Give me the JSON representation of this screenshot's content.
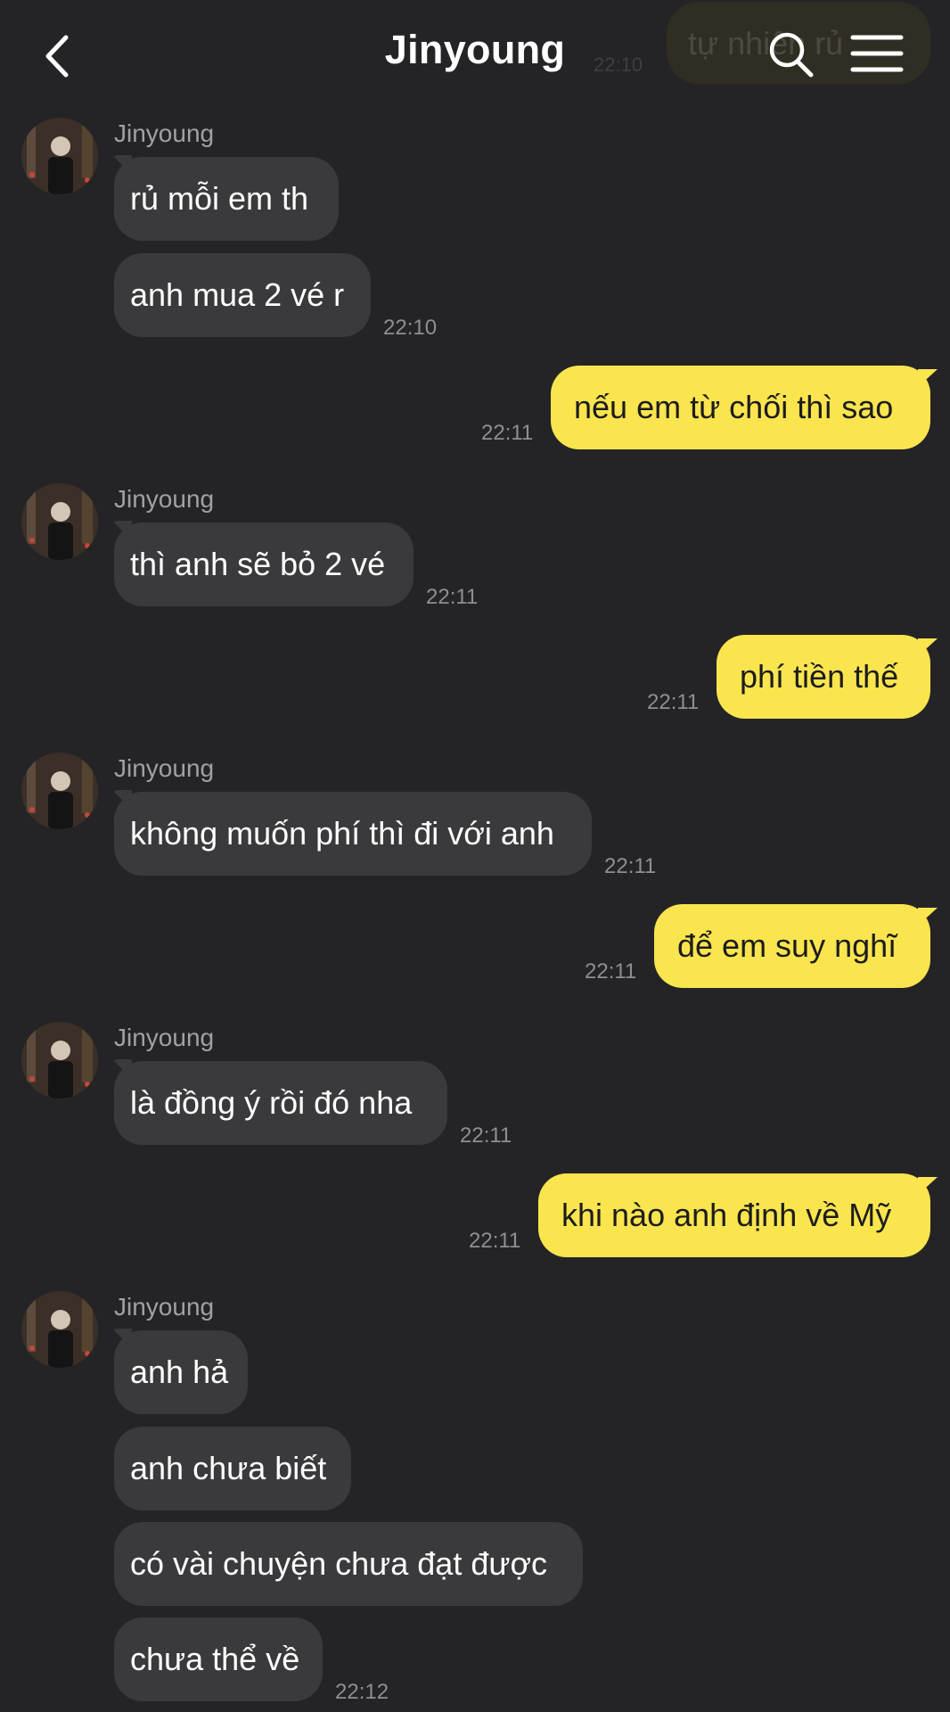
{
  "header": {
    "title": "Jinyoung",
    "background_message": "tự nhiên rủ",
    "background_time": "22:10"
  },
  "contact_name": "Jinyoung",
  "messages": {
    "g1": {
      "sender": "Jinyoung",
      "m1": "rủ mỗi em th",
      "m2": "anh mua 2 vé r",
      "time": "22:10"
    },
    "o1": {
      "text": "nếu em từ chối thì sao",
      "time": "22:11"
    },
    "g2": {
      "sender": "Jinyoung",
      "m1": "thì anh sẽ bỏ 2 vé",
      "time": "22:11"
    },
    "o2": {
      "text": "phí tiền thế",
      "time": "22:11"
    },
    "g3": {
      "sender": "Jinyoung",
      "m1": "không muốn phí thì đi với anh",
      "time": "22:11"
    },
    "o3": {
      "text": "để em suy nghĩ",
      "time": "22:11"
    },
    "g4": {
      "sender": "Jinyoung",
      "m1": "là đồng ý rồi đó nha",
      "time": "22:11"
    },
    "o4": {
      "text": "khi nào anh định về Mỹ",
      "time": "22:11"
    },
    "g5": {
      "sender": "Jinyoung",
      "m1": "anh hả",
      "m2": "anh chưa biết",
      "m3": "có vài chuyện chưa đạt được",
      "m4": "chưa thể về",
      "time": "22:12"
    }
  },
  "colors": {
    "background": "#242426",
    "incoming_bubble": "#3a3a3c",
    "outgoing_bubble": "#fae54f",
    "timestamp": "#8e8e93"
  },
  "icons": {
    "back": "chevron-left-icon",
    "search": "search-icon",
    "menu": "hamburger-menu-icon"
  }
}
